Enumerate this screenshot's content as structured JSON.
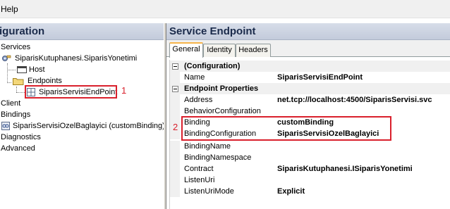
{
  "menubar": {
    "help_label": "Help"
  },
  "left": {
    "header_title": "iguration",
    "tree": {
      "services": "Services",
      "service_name": "SiparisKutuphanesi.SiparisYonetimi",
      "host": "Host",
      "endpoints": "Endpoints",
      "endpoint_name": "SiparisServisiEndPoint",
      "client": "Client",
      "bindings": "Bindings",
      "binding_item": "SiparisServisiOzelBaglayici (customBinding)",
      "diagnostics": "Diagnostics",
      "advanced": "Advanced"
    },
    "callout_1": "1"
  },
  "right": {
    "header_title": "Service Endpoint",
    "tabs": [
      {
        "label": "General"
      },
      {
        "label": "Identity"
      },
      {
        "label": "Headers"
      }
    ],
    "callout_2": "2",
    "properties": {
      "cat_configuration": "(Configuration)",
      "name_label": "Name",
      "name_value": "SiparisServisiEndPoint",
      "cat_endpoint": "Endpoint Properties",
      "address_label": "Address",
      "address_value": "net.tcp://localhost:4500/SiparisServisi.svc",
      "behavior_label": "BehaviorConfiguration",
      "behavior_value": "",
      "binding_label": "Binding",
      "binding_value": "customBinding",
      "bindingconfig_label": "BindingConfiguration",
      "bindingconfig_value": "SiparisServisiOzelBaglayici",
      "bindingname_label": "BindingName",
      "bindingname_value": "",
      "bindingns_label": "BindingNamespace",
      "bindingns_value": "",
      "contract_label": "Contract",
      "contract_value": "SiparisKutuphanesi.ISiparisYonetimi",
      "listenuri_label": "ListenUri",
      "listenuri_value": "",
      "listenurimode_label": "ListenUriMode",
      "listenurimode_value": "Explicit"
    }
  },
  "colors": {
    "highlight_red": "#d9202c",
    "header_blue": "#c3cbdb",
    "tab_accent": "#f7b54a"
  }
}
